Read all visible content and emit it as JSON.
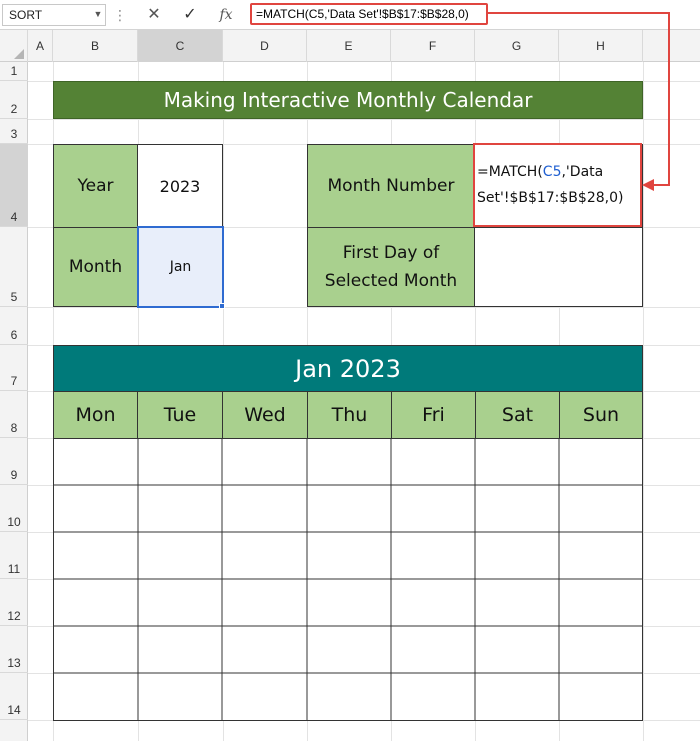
{
  "formula_bar": {
    "name_box": "SORT",
    "formula": "=MATCH(C5,'Data Set'!$B$17:$B$28,0)",
    "icons": [
      "cancel-icon",
      "enter-icon",
      "fx-icon"
    ],
    "fx_label": "fx"
  },
  "columns": [
    "A",
    "B",
    "C",
    "D",
    "E",
    "F",
    "G",
    "H"
  ],
  "rows": [
    "1",
    "2",
    "3",
    "4",
    "5",
    "6",
    "7",
    "8",
    "9",
    "10",
    "11",
    "12",
    "13",
    "14"
  ],
  "title": "Making Interactive Monthly Calendar",
  "inputs": {
    "year_label": "Year",
    "year_value": "2023",
    "month_label": "Month",
    "month_value": "Jan"
  },
  "calc": {
    "month_number_label": "Month Number",
    "month_number_formula_line1_prefix": "=MATCH(",
    "month_number_formula_ref": "C5",
    "month_number_formula_line1_suffix": ",'Data",
    "month_number_formula_line2": "Set'!$B$17:$B$28,0)",
    "first_day_label_line1": "First Day of",
    "first_day_label_line2": "Selected Month",
    "first_day_value": ""
  },
  "calendar": {
    "header": "Jan 2023",
    "weekdays": [
      "Mon",
      "Tue",
      "Wed",
      "Thu",
      "Fri",
      "Sat",
      "Sun"
    ]
  },
  "colors": {
    "title_green": "#548235",
    "label_green": "#a9d08e",
    "calendar_teal": "#007a7a",
    "highlight_red": "#e0453f",
    "selection_blue": "#2f6bd1"
  }
}
